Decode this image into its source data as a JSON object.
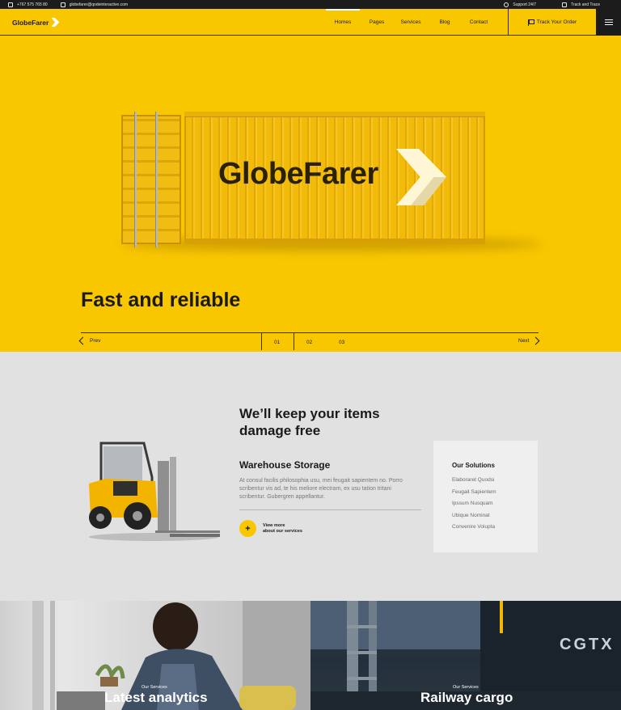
{
  "topbar": {
    "phone": "+767 575 765 80",
    "email": "globefarer@qodeinteractive.com",
    "support": "Support 24/7",
    "track_trace": "Track and Trace"
  },
  "header": {
    "logo": "GlobeFarer",
    "nav": [
      {
        "label": "Homes",
        "active": true
      },
      {
        "label": "Pages"
      },
      {
        "label": "Services"
      },
      {
        "label": "Blog"
      },
      {
        "label": "Contact"
      }
    ],
    "track_order": "Track Your Order"
  },
  "hero": {
    "container_brand": "GlobeFarer",
    "title": "Fast and reliable",
    "prev": "Prev",
    "next": "Next",
    "slides": [
      "01",
      "02",
      "03"
    ]
  },
  "services": {
    "heading": "We’ll keep your items damage free",
    "subheading": "Warehouse Storage",
    "text": "At consul facilis philosophia usu, mei feugait sapientem no. Porro scribentur vis ad, te his meliore electram, ex usu tation tritani scribentur. Gubergren appellantur.",
    "cta_line1": "View more",
    "cta_line2": "about our services",
    "solutions": {
      "title": "Our Solutions",
      "items": [
        "Elaboraret Quodsi",
        "Feugait Sapientem",
        "Ipssum Nusquam",
        "Ubique Nominat",
        "Convenire Volupta"
      ]
    }
  },
  "cards": [
    {
      "small": "Our Services",
      "big": "Latest analytics"
    },
    {
      "small": "Our Services",
      "big": "Railway cargo",
      "sign": "CGTX"
    }
  ],
  "colors": {
    "brand_yellow": "#f9c700",
    "dark": "#1c1c1c",
    "section_gray": "#e1e1e1"
  }
}
